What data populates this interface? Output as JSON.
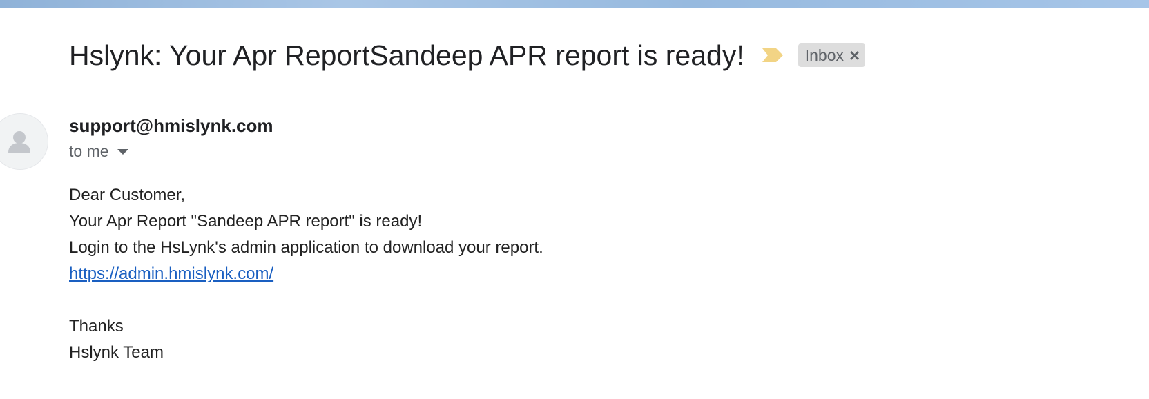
{
  "subject": {
    "title": "Hslynk: Your Apr ReportSandeep APR report is ready!",
    "importance_icon": "importance-marker-icon",
    "label": {
      "text": "Inbox",
      "remove_glyph": "×"
    }
  },
  "sender": {
    "avatar_icon": "person-avatar-icon",
    "email": "support@hmislynk.com",
    "recipient_text": "to me",
    "details_icon": "chevron-down-icon"
  },
  "body": {
    "greeting": "Dear Customer,",
    "line1": "Your Apr Report \"Sandeep APR report\" is ready!",
    "line2": "Login to the HsLynk's admin application to download your report.",
    "link": "https://admin.hmislynk.com/",
    "thanks": "Thanks",
    "signature": "Hslynk Team"
  },
  "colors": {
    "top_strip": "#9dbde2",
    "importance_marker": "#f2d485",
    "label_chip_bg": "#dddddd",
    "link": "#1a5fc1",
    "text_primary": "#202124",
    "text_secondary": "#5f6368"
  }
}
